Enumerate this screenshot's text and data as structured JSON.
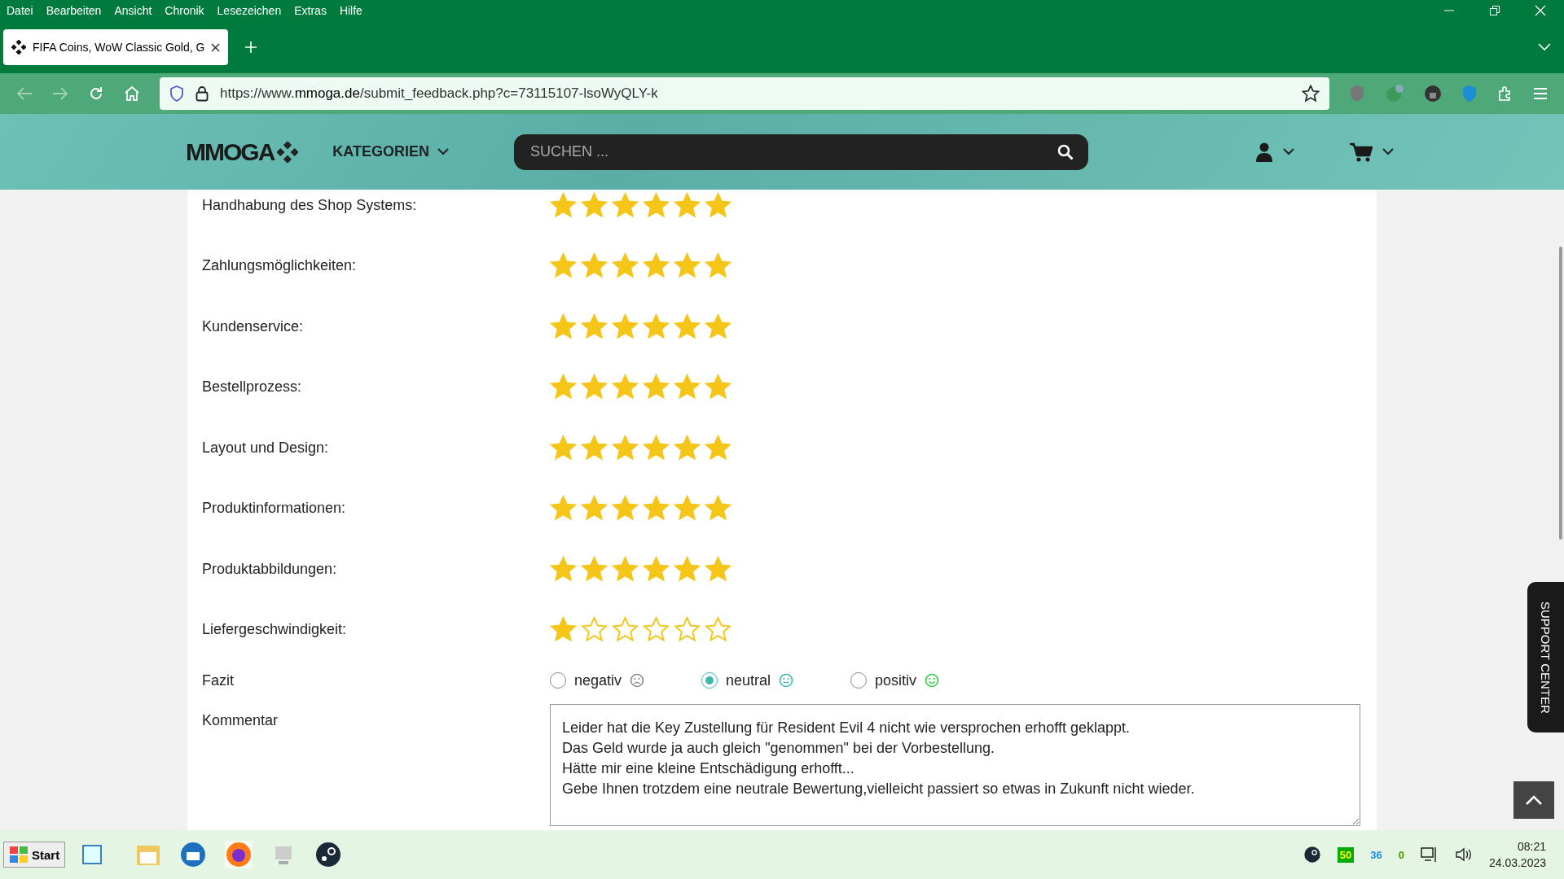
{
  "menu": [
    "Datei",
    "Bearbeiten",
    "Ansicht",
    "Chronik",
    "Lesezeichen",
    "Extras",
    "Hilfe"
  ],
  "tab": {
    "title": "FIFA Coins, WoW Classic Gold, G",
    "selected": true
  },
  "url": {
    "host_prefix": "https://www.",
    "host": "mmoga.de",
    "path": "/submit_feedback.php?c=73115107-lsoWyQLY-k"
  },
  "site": {
    "logo": "MMOGA",
    "categories": "KATEGORIEN",
    "search": {
      "placeholder": "SUCHEN ..."
    }
  },
  "ratings": [
    {
      "label": "Handhabung des Shop Systems:",
      "stars": 6
    },
    {
      "label": "Zahlungsmöglichkeiten:",
      "stars": 6
    },
    {
      "label": "Kundenservice:",
      "stars": 6
    },
    {
      "label": "Bestellprozess:",
      "stars": 6
    },
    {
      "label": "Layout und Design:",
      "stars": 6
    },
    {
      "label": "Produktinformationen:",
      "stars": 6
    },
    {
      "label": "Produktabbildungen:",
      "stars": 6
    },
    {
      "label": "Liefergeschwindigkeit:",
      "stars": 1
    }
  ],
  "fazit": {
    "label": "Fazit",
    "options": [
      {
        "label": "negativ",
        "selected": false,
        "kind": "sad",
        "color": "#8a8a8a"
      },
      {
        "label": "neutral",
        "selected": true,
        "kind": "neutral",
        "color": "#3bb8b0"
      },
      {
        "label": "positiv",
        "selected": false,
        "kind": "happy",
        "color": "#2ecc40"
      }
    ]
  },
  "comment": {
    "label": "Kommentar",
    "value": "Leider hat die Key Zustellung für Resident Evil 4 nicht wie versprochen erhofft geklappt.\nDas Geld wurde ja auch gleich \"genommen\" bei der Vorbestellung.\nHätte mir eine kleine Entschädigung erhofft...\nGebe Ihnen trotzdem eine neutrale Bewertung,vielleicht passiert so etwas in Zukunft nicht wieder."
  },
  "support_center": "SUPPORT CENTER",
  "taskbar": {
    "start": "Start",
    "tray": [
      "50",
      "36",
      "0"
    ],
    "time": "08:21",
    "date": "24.03.2023"
  }
}
